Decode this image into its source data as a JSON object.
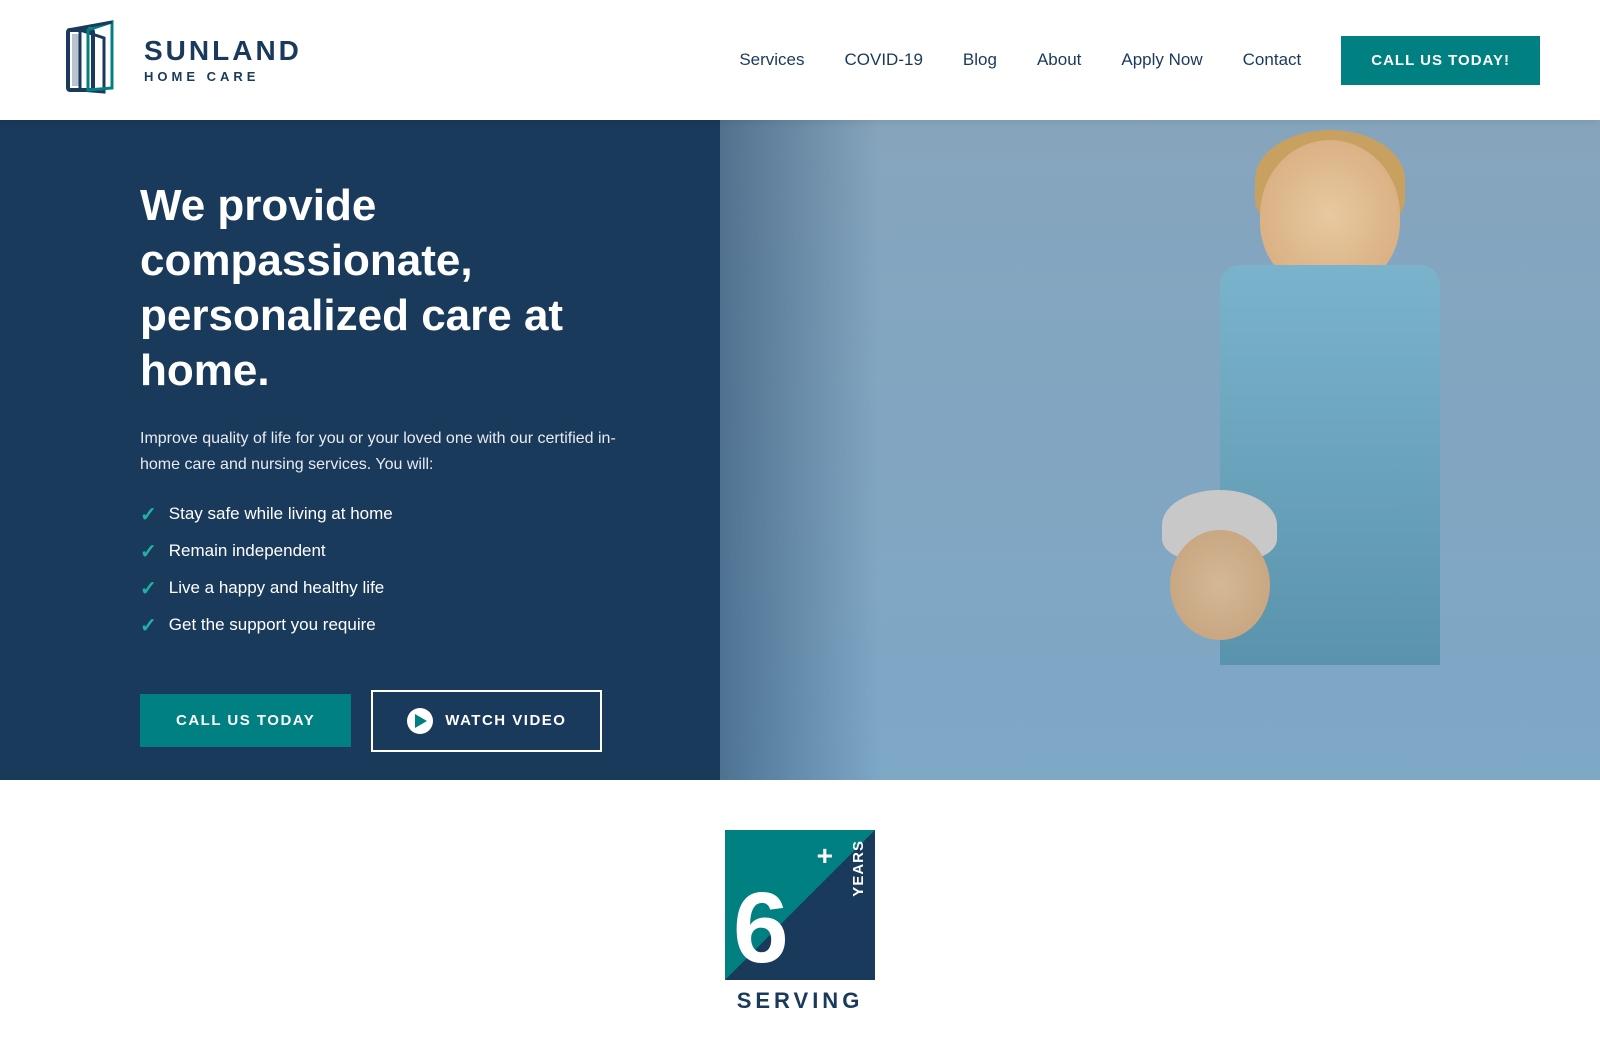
{
  "brand": {
    "name_line1": "SUNLAND",
    "name_line2": "HOME CARE"
  },
  "nav": {
    "items": [
      {
        "label": "Services",
        "id": "services"
      },
      {
        "label": "COVID-19",
        "id": "covid"
      },
      {
        "label": "Blog",
        "id": "blog"
      },
      {
        "label": "About",
        "id": "about"
      },
      {
        "label": "Apply Now",
        "id": "apply"
      },
      {
        "label": "Contact",
        "id": "contact"
      }
    ],
    "cta_button": "CALL US TODAY!"
  },
  "hero": {
    "heading": "We provide compassionate, personalized care at home.",
    "subtext": "Improve quality of life for you or your loved one with our certified in-home care and nursing services. You will:",
    "checklist": [
      "Stay safe while living at home",
      "Remain independent",
      "Live a happy and healthy life",
      "Get the support you require"
    ],
    "btn_call": "CALL US TODAY",
    "btn_watch": "WATCH VIDEO"
  },
  "badge": {
    "number": "6",
    "plus": "+",
    "years": "YEARS",
    "serving": "SERVING"
  },
  "colors": {
    "teal": "#008080",
    "navy": "#1a3a5c",
    "white": "#ffffff",
    "check": "#20b2aa"
  }
}
